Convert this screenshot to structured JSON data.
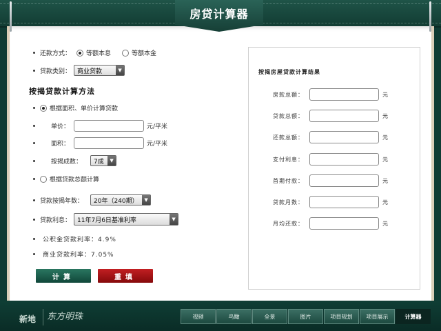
{
  "header": {
    "title": "房贷计算器"
  },
  "form": {
    "repay_method_label": "还款方式：",
    "repay_options": [
      {
        "label": "等额本息",
        "selected": true
      },
      {
        "label": "等额本金",
        "selected": false
      }
    ],
    "loan_type_label": "贷款类别：",
    "loan_type_value": "商业贷款",
    "mortgage_method_title": "按揭贷款计算方法",
    "method_area_label": "根据面积、单价计算贷款",
    "unit_price_label": "单价：",
    "unit_price_unit": "元/平米",
    "area_label": "面积：",
    "area_unit": "元/平米",
    "ratio_label": "按揭成数：",
    "ratio_value": "7成",
    "method_total_label": "根据贷款总额计算",
    "years_label": "贷款按揭年数：",
    "years_value": "20年（240期）",
    "rate_label": "贷款利息：",
    "rate_value": "11年7月6日基准利率",
    "fund_rate_text": "公积金贷款利率：4.9%",
    "commercial_rate_text": "商业贷款利率：7.05%",
    "calc_button": "计算",
    "reset_button": "重填"
  },
  "results": {
    "title": "按揭房屋贷款计算结果",
    "unit": "元",
    "rows": [
      {
        "label": "房款总额："
      },
      {
        "label": "贷款总额："
      },
      {
        "label": "还款总额："
      },
      {
        "label": "支付利息："
      },
      {
        "label": "首期付款："
      },
      {
        "label": "贷款月数："
      },
      {
        "label": "月均还款："
      }
    ]
  },
  "footer": {
    "logo_text1": "新地",
    "logo_text2": "东方明珠",
    "nav": [
      {
        "label": "视频",
        "active": false
      },
      {
        "label": "鸟瞰",
        "active": false
      },
      {
        "label": "全景",
        "active": false
      },
      {
        "label": "图片",
        "active": false
      },
      {
        "label": "项目规划",
        "active": false
      },
      {
        "label": "项目展示",
        "active": false
      },
      {
        "label": "计算器",
        "active": true
      }
    ]
  },
  "colors": {
    "frame": "#0f3b33",
    "calc_button": "#1a5c4a",
    "reset_button": "#a3161a"
  }
}
